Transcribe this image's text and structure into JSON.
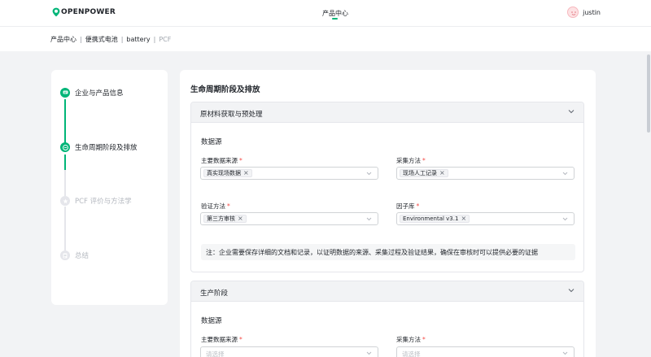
{
  "header": {
    "brand": "OPENPOWER",
    "nav_center": "产品中心",
    "user_name": "justin"
  },
  "breadcrumb": {
    "items": [
      "产品中心",
      "便携式电池",
      "battery"
    ],
    "separator": "|",
    "current": "PCF"
  },
  "stepper": {
    "steps": [
      {
        "label": "企业与产品信息",
        "state": "active",
        "icon": "message-icon"
      },
      {
        "label": "生命周期阶段及排放",
        "state": "active",
        "icon": "minus-icon"
      },
      {
        "label": "PCF 评价与方法学",
        "state": "inactive",
        "icon": "star-icon"
      },
      {
        "label": "总结",
        "state": "inactive",
        "icon": "document-icon"
      }
    ]
  },
  "main": {
    "title": "生命周期阶段及排放",
    "sections": [
      {
        "title": "原材料获取与预处理",
        "source_label": "数据源",
        "fields": [
          {
            "label": "主要数据来源",
            "required_mark": "*",
            "tag": "真实现场数据",
            "placeholder": ""
          },
          {
            "label": "采集方法",
            "required_mark": "*",
            "tag": "现场人工记录",
            "placeholder": ""
          },
          {
            "label": "验证方法",
            "required_mark": "*",
            "tag": "第三方审核",
            "placeholder": ""
          },
          {
            "label": "因子库",
            "required_mark": "*",
            "tag": "Environmental v3.1",
            "placeholder": ""
          }
        ],
        "note": "注：企业需要保存详细的文档和记录，以证明数据的来源、采集过程及验证结果，确保在审核时可以提供必要的证据"
      },
      {
        "title": "生产阶段",
        "source_label": "数据源",
        "fields": [
          {
            "label": "主要数据来源",
            "required_mark": "*",
            "tag": "",
            "placeholder": "请选择"
          },
          {
            "label": "采集方法",
            "required_mark": "*",
            "tag": "",
            "placeholder": "请选择"
          }
        ]
      }
    ]
  },
  "colors": {
    "accent": "#00b578",
    "required": "#f54a45",
    "background": "#f2f3f5"
  }
}
